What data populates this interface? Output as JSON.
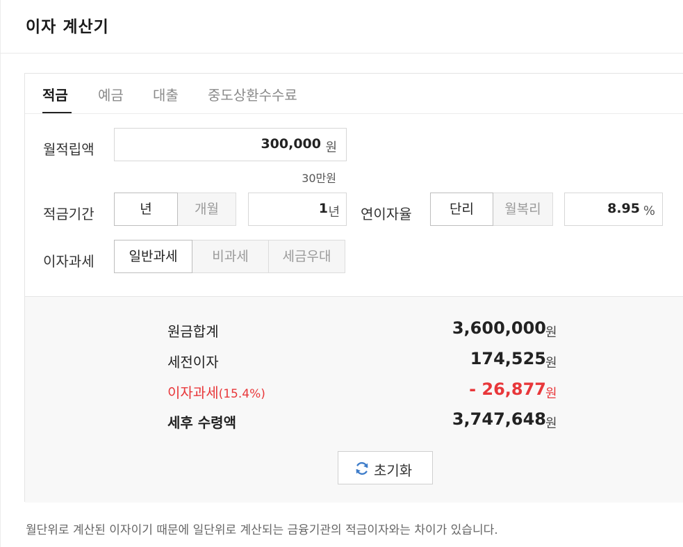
{
  "header": {
    "title": "이자 계산기"
  },
  "tabs": [
    {
      "label": "적금",
      "active": true
    },
    {
      "label": "예금",
      "active": false
    },
    {
      "label": "대출",
      "active": false
    },
    {
      "label": "중도상환수수료",
      "active": false
    }
  ],
  "form": {
    "monthly_amount": {
      "label": "월적립액",
      "value": "300,000",
      "unit": "원",
      "hint": "30만원"
    },
    "period": {
      "label": "적금기간",
      "options": [
        "년",
        "개월"
      ],
      "selected": "년",
      "value": "1",
      "unit": "년"
    },
    "rate": {
      "label": "연이자율",
      "options": [
        "단리",
        "월복리"
      ],
      "selected": "단리",
      "value": "8.95",
      "unit": "%"
    },
    "tax": {
      "label": "이자과세",
      "options": [
        "일반과세",
        "비과세",
        "세금우대"
      ],
      "selected": "일반과세"
    }
  },
  "results": {
    "principal": {
      "label": "원금합계",
      "value": "3,600,000",
      "unit": "원"
    },
    "pretax_interest": {
      "label": "세전이자",
      "value": "174,525",
      "unit": "원"
    },
    "interest_tax": {
      "label": "이자과세",
      "rate": "(15.4%)",
      "value": "- 26,877",
      "unit": "원"
    },
    "after_tax": {
      "label": "세후 수령액",
      "value": "3,747,648",
      "unit": "원"
    }
  },
  "reset_button": {
    "label": "초기화",
    "icon": "refresh-icon"
  },
  "footnote": "월단위로 계산된 이자이기 때문에 일단위로 계산되는 금융기관의 적금이자와는 차이가 있습니다.",
  "colors": {
    "tax_red": "#e8373a",
    "refresh_blue": "#3d7cc9"
  }
}
